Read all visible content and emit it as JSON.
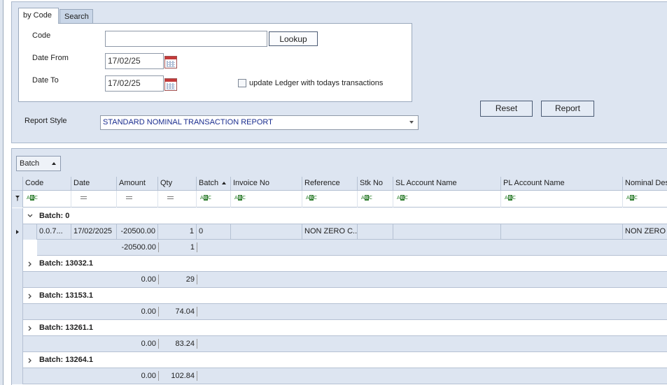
{
  "tabs": [
    {
      "label": "by Code",
      "active": true
    },
    {
      "label": "Search",
      "active": false
    }
  ],
  "form": {
    "code_label": "Code",
    "code_value": "",
    "lookup_label": "Lookup",
    "date_from_label": "Date From",
    "date_from_value": "17/02/25",
    "date_to_label": "Date To",
    "date_to_value": "17/02/25",
    "update_ledger_label": "update Ledger with todays transactions",
    "update_ledger_checked": false
  },
  "actions": {
    "reset_label": "Reset",
    "report_label": "Report"
  },
  "report_style": {
    "label": "Report Style",
    "value": "STANDARD NOMINAL TRANSACTION REPORT"
  },
  "grid": {
    "group_by_label": "Batch",
    "columns": [
      "Code",
      "Date",
      "Amount",
      "Qty",
      "Batch",
      "Invoice No",
      "Reference",
      "Stk No",
      "SL Account Name",
      "PL Account Name",
      "Nominal Desc"
    ],
    "groups": [
      {
        "title": "Batch: 0",
        "expanded": true,
        "rows": [
          {
            "code": "0.0.7...",
            "date": "17/02/2025",
            "amount": "-20500.00",
            "qty": "1",
            "batch": "0",
            "invoice_no": "",
            "reference": "NON ZERO C...",
            "stk_no": "",
            "sl_account_name": "",
            "pl_account_name": "",
            "nominal_desc": "NON ZERO C"
          }
        ],
        "sum_amount": "-20500.00",
        "sum_qty": "1"
      },
      {
        "title": "Batch: 13032.1",
        "expanded": false,
        "sum_amount": "0.00",
        "sum_qty": "29"
      },
      {
        "title": "Batch: 13153.1",
        "expanded": false,
        "sum_amount": "0.00",
        "sum_qty": "74.04"
      },
      {
        "title": "Batch: 13261.1",
        "expanded": false,
        "sum_amount": "0.00",
        "sum_qty": "83.24"
      },
      {
        "title": "Batch: 13264.1",
        "expanded": false,
        "sum_amount": "0.00",
        "sum_qty": "102.84"
      }
    ]
  },
  "colors": {
    "panel": "#dde5f1",
    "link_text": "#1a2d8f",
    "border": "#99a8bc"
  }
}
